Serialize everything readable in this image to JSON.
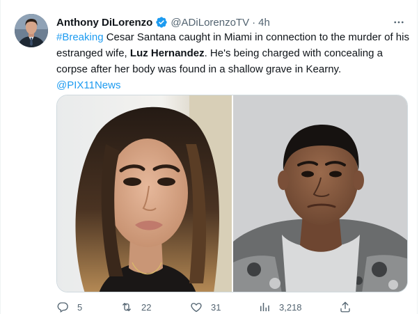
{
  "author": {
    "display_name": "Anthony DiLorenzo",
    "handle": "@ADiLorenzoTV",
    "separator": "·",
    "time": "4h",
    "verified": true
  },
  "tweet": {
    "hashtag": "#Breaking",
    "text_part1": " Cesar Santana caught in Miami in connection to the murder of his estranged wife, ",
    "bold_name": "Luz Hernandez",
    "text_part2": ". He's being charged with concealing a corpse after her body was found in a shallow grave in Kearny.",
    "mention": "@PIX11News"
  },
  "actions": {
    "replies": "5",
    "retweets": "22",
    "likes": "31",
    "views": "3,218"
  },
  "colors": {
    "link": "#1d9bf0",
    "secondary_text": "#536471",
    "primary_text": "#0f1419",
    "verified_badge": "#1d9bf0"
  },
  "icons": {
    "more": "more-horizontal-icon",
    "reply": "reply-icon",
    "retweet": "retweet-icon",
    "like": "heart-icon",
    "views": "views-chart-icon",
    "share": "share-icon",
    "verified": "verified-badge-icon"
  }
}
